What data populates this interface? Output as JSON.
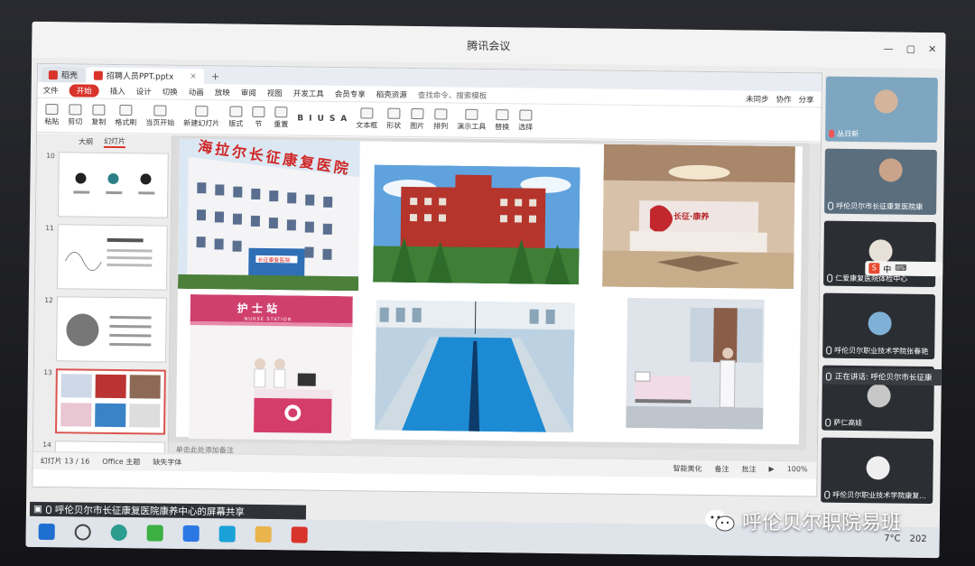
{
  "meeting": {
    "title": "腾讯会议",
    "share_banner": "呼伦贝尔市长征康复医院康养中心的屏幕共享",
    "speaking": "正在讲话: 呼伦贝尔市长征康"
  },
  "wps": {
    "tabs": [
      {
        "label": "稻壳"
      },
      {
        "label": "招聘人员PPT.pptx"
      }
    ],
    "menu": [
      "文件",
      "开始",
      "插入",
      "设计",
      "切换",
      "动画",
      "放映",
      "审阅",
      "视图",
      "开发工具",
      "会员专享",
      "稻壳资源"
    ],
    "search_placeholder": "查找命令、搜索模板",
    "ribbon": [
      "粘贴",
      "剪切",
      "复制",
      "格式刷",
      "当页开始",
      "新建幻灯片",
      "版式",
      "节",
      "重置",
      "文本框",
      "形状",
      "图片",
      "排列",
      "演示工具",
      "替换",
      "选择"
    ],
    "ribbon_right": [
      "未同步",
      "协作",
      "分享"
    ],
    "thumb_tabs": [
      "大纲",
      "幻灯片"
    ],
    "thumb_numbers": [
      "10",
      "11",
      "12",
      "13",
      "14"
    ],
    "slide_title": "海拉尔长征康复医院",
    "nurse_station": "护 士 站",
    "nurse_station_en": "NURSE STATION",
    "reception_sign": "长征·康养",
    "building_sign": "长征康复医院",
    "notes_placeholder": "单击此处添加备注",
    "status_left": [
      "幻灯片 13 / 16",
      "Office 主题",
      "缺失字体"
    ],
    "status_right": [
      "智能美化",
      "备注",
      "批注",
      "100%"
    ]
  },
  "participants": [
    {
      "name": "丛日新"
    },
    {
      "name": "呼伦贝尔市长征康复医院康"
    },
    {
      "name": "仁爱康复医院体检中心"
    },
    {
      "name": "呼伦贝尔职业技术学院张春艳"
    },
    {
      "name": "萨仁高娃"
    },
    {
      "name": "呼伦贝尔职业技术学院康复..."
    }
  ],
  "ime": {
    "label": "中"
  },
  "taskbar": {
    "weather": "7°C",
    "time": "202"
  },
  "watermark": {
    "text": "呼伦贝尔职院易班"
  },
  "colors": {
    "accent": "#d9342b",
    "meeting_bg": "#2b2e33"
  }
}
